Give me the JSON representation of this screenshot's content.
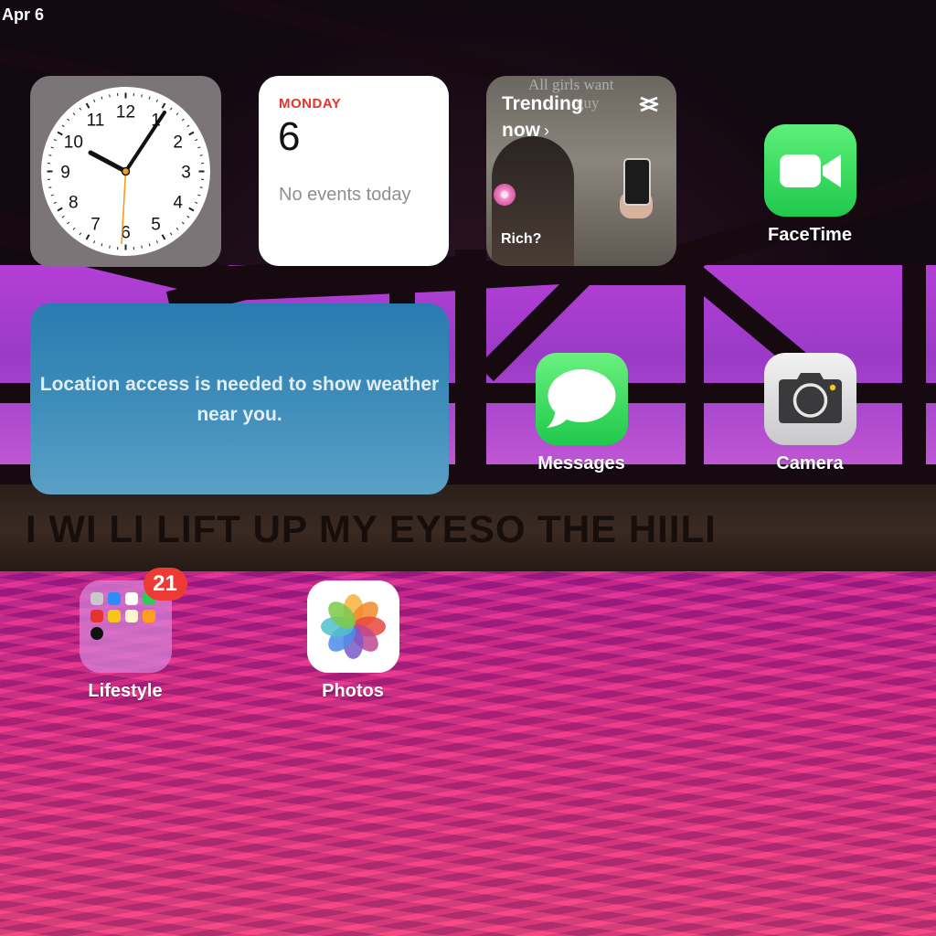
{
  "status": {
    "date": "Apr 6"
  },
  "wallpaper": {
    "banner_text": "I WI LI LIFT UP MY EYESO THE HIILI"
  },
  "widgets": {
    "clock": {
      "numerals": [
        "12",
        "1",
        "2",
        "3",
        "4",
        "5",
        "6",
        "7",
        "8",
        "9",
        "10",
        "11"
      ]
    },
    "calendar": {
      "day": "MONDAY",
      "date": "6",
      "events": "No events today"
    },
    "trending": {
      "title": "Trending now",
      "chevron": "›",
      "bg_text_1": "All girls want",
      "bg_text_2": "guy",
      "caption": "Rich?",
      "logo_icon": "capcut-icon"
    },
    "weather": {
      "message": "Location access is needed to show weather near you."
    }
  },
  "apps": {
    "facetime": {
      "label": "FaceTime",
      "icon": "video-camera-icon"
    },
    "messages": {
      "label": "Messages",
      "icon": "speech-bubble-icon"
    },
    "camera": {
      "label": "Camera",
      "icon": "camera-icon"
    },
    "lifestyle": {
      "label": "Lifestyle",
      "badge": "21",
      "mini_icons": [
        "contacts",
        "mail",
        "calendar",
        "facetime",
        "news",
        "tips",
        "notes",
        "shortcuts",
        "clock"
      ]
    },
    "photos": {
      "label": "Photos",
      "icon": "photos-flower-icon"
    }
  },
  "colors": {
    "calendar_red": "#e8322d",
    "badge_red": "#ee3a35",
    "facetime_green": "#1fc94b",
    "weather_blue": "#2a7bb0"
  }
}
